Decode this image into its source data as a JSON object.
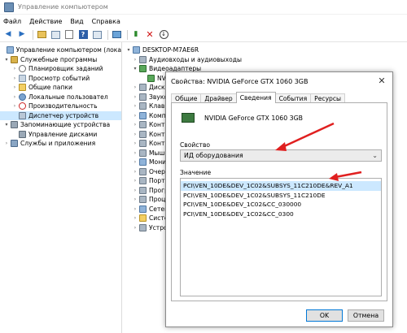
{
  "window": {
    "title": "Управление компьютером"
  },
  "menu": [
    "Файл",
    "Действие",
    "Вид",
    "Справка"
  ],
  "toolbar_icons": [
    "back-arrow-icon",
    "forward-arrow-icon",
    "up-folder-icon",
    "console-tree-icon",
    "properties-icon",
    "help-icon",
    "panel-icon",
    "monitor-icon",
    "update-driver-icon",
    "delete-icon",
    "download-icon"
  ],
  "left_tree": [
    {
      "label": "Управление компьютером (лока",
      "level": 0,
      "arrow": "",
      "icon": "computer-icon"
    },
    {
      "label": "Служебные программы",
      "level": 1,
      "arrow": "▾",
      "icon": "tools-icon"
    },
    {
      "label": "Планировщик заданий",
      "level": 2,
      "arrow": "›",
      "icon": "clock-icon"
    },
    {
      "label": "Просмотр событий",
      "level": 2,
      "arrow": "›",
      "icon": "event-log-icon"
    },
    {
      "label": "Общие папки",
      "level": 2,
      "arrow": "›",
      "icon": "shared-folder-icon"
    },
    {
      "label": "Локальные пользовател",
      "level": 2,
      "arrow": "›",
      "icon": "users-icon"
    },
    {
      "label": "Производительность",
      "level": 2,
      "arrow": "›",
      "icon": "performance-icon"
    },
    {
      "label": "Диспетчер устройств",
      "level": 2,
      "arrow": "",
      "icon": "device-manager-icon",
      "selected": true
    },
    {
      "label": "Запоминающие устройства",
      "level": 1,
      "arrow": "▾",
      "icon": "storage-icon"
    },
    {
      "label": "Управление дисками",
      "level": 2,
      "arrow": "",
      "icon": "disk-icon"
    },
    {
      "label": "Службы и приложения",
      "level": 1,
      "arrow": "›",
      "icon": "services-icon"
    }
  ],
  "right_tree": [
    {
      "label": "DESKTOP-M7AE6R",
      "level": 0,
      "arrow": "▾",
      "icon": "computer-icon"
    },
    {
      "label": "Аудиовходы и аудиовыходы",
      "level": 1,
      "arrow": "›",
      "icon": "audio-icon"
    },
    {
      "label": "Видеоадаптеры",
      "level": 1,
      "arrow": "▾",
      "icon": "display-adapter-icon"
    },
    {
      "label": "NVI",
      "level": 2,
      "arrow": "",
      "icon": "gpu-icon"
    },
    {
      "label": "Дисков",
      "level": 1,
      "arrow": "›",
      "icon": "disk-drive-icon"
    },
    {
      "label": "Звуков",
      "level": 1,
      "arrow": "›",
      "icon": "sound-icon"
    },
    {
      "label": "Клавиа",
      "level": 1,
      "arrow": "›",
      "icon": "keyboard-icon"
    },
    {
      "label": "Компью",
      "level": 1,
      "arrow": "›",
      "icon": "computer-icon"
    },
    {
      "label": "Контро",
      "level": 1,
      "arrow": "›",
      "icon": "controller-icon"
    },
    {
      "label": "Контро",
      "level": 1,
      "arrow": "›",
      "icon": "controller-icon"
    },
    {
      "label": "Контро",
      "level": 1,
      "arrow": "›",
      "icon": "controller-icon"
    },
    {
      "label": "Мыши",
      "level": 1,
      "arrow": "›",
      "icon": "mouse-icon"
    },
    {
      "label": "Монито",
      "level": 1,
      "arrow": "›",
      "icon": "monitor-icon"
    },
    {
      "label": "Очеред",
      "level": 1,
      "arrow": "›",
      "icon": "printer-icon"
    },
    {
      "label": "Порты",
      "level": 1,
      "arrow": "›",
      "icon": "port-icon"
    },
    {
      "label": "Програ",
      "level": 1,
      "arrow": "›",
      "icon": "software-icon"
    },
    {
      "label": "Процес",
      "level": 1,
      "arrow": "›",
      "icon": "processor-icon"
    },
    {
      "label": "Сетевы",
      "level": 1,
      "arrow": "›",
      "icon": "network-icon"
    },
    {
      "label": "Систем",
      "level": 1,
      "arrow": "›",
      "icon": "system-icon"
    },
    {
      "label": "Устрой",
      "level": 1,
      "arrow": "›",
      "icon": "device-icon"
    }
  ],
  "dialog": {
    "title": "Свойства: NVIDIA GeForce GTX 1060 3GB",
    "tabs": [
      "Общие",
      "Драйвер",
      "Сведения",
      "События",
      "Ресурсы"
    ],
    "active_tab": "Сведения",
    "device_name": "NVIDIA GeForce GTX 1060 3GB",
    "property_label": "Свойство",
    "property_value": "ИД оборудования",
    "value_label": "Значение",
    "values": [
      "PCI\\VEN_10DE&DEV_1C02&SUBSYS_11C210DE&REV_A1",
      "PCI\\VEN_10DE&DEV_1C02&SUBSYS_11C210DE",
      "PCI\\VEN_10DE&DEV_1C02&CC_030000",
      "PCI\\VEN_10DE&DEV_1C02&CC_0300"
    ],
    "ok_label": "OK",
    "cancel_label": "Отмена"
  },
  "colors": {
    "selection": "#cce8ff",
    "annotation_arrow": "#e02020"
  }
}
